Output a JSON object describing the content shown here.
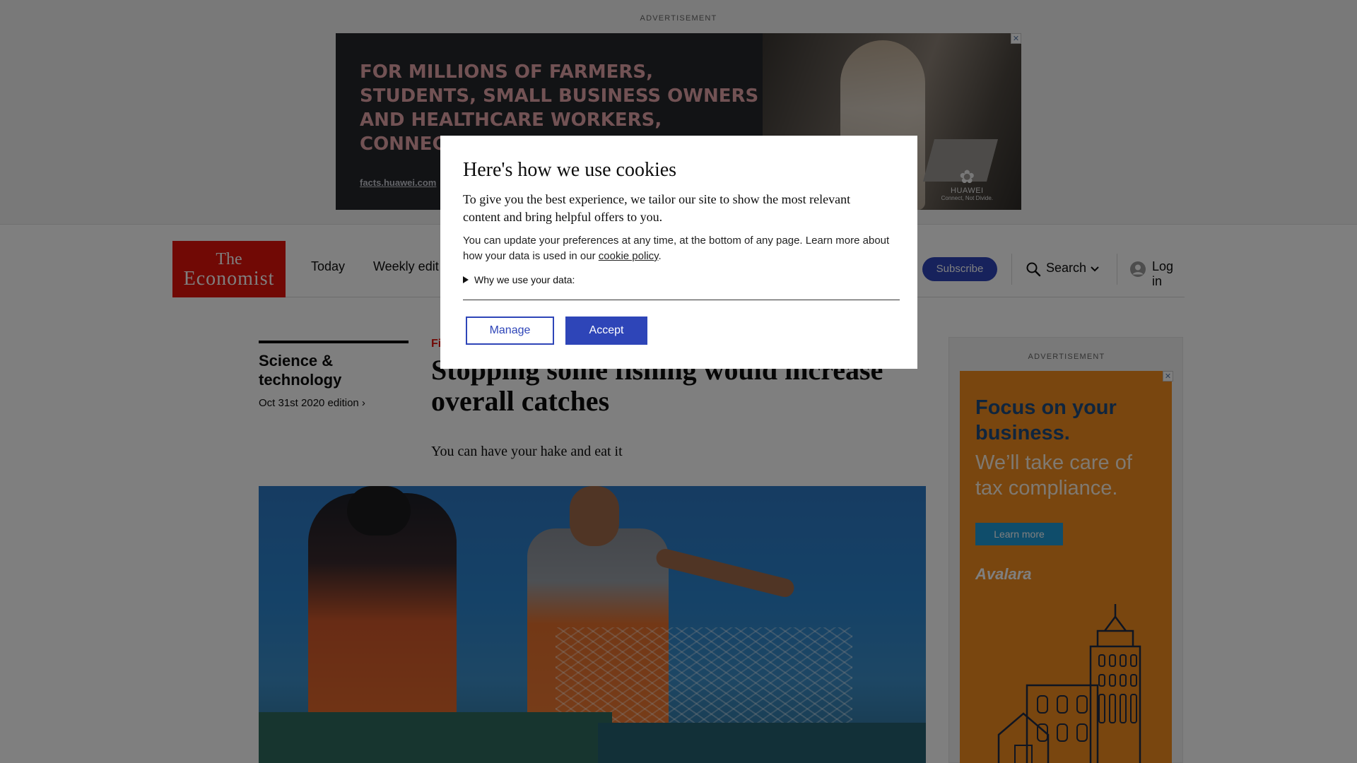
{
  "top_ad": {
    "label": "ADVERTISEMENT",
    "copy": "FOR MILLIONS OF FARMERS, STUDENTS, SMALL BUSINESS OWNERS AND HEALTHCARE WORKERS, CONNECTIVITY IS MORE CR",
    "url": "facts.huawei.com",
    "brand_name": "HUAWEI",
    "brand_tagline": "Connect, Not Divide.",
    "close_glyph": "✕"
  },
  "nav": {
    "logo_line1": "The",
    "logo_line2": "Economist",
    "links": [
      "Today",
      "Weekly edit"
    ],
    "subscribe_label": "Subscribe",
    "search_label": "Search",
    "login_label": "Log in",
    "icons": [
      "search-icon",
      "chevron-down-icon",
      "user-icon"
    ]
  },
  "article": {
    "section": "Science & technology",
    "edition_link": "Oct 31st 2020 edition ›",
    "flytitle": "Fi",
    "headline": "Stopping some fishing would increase overall catches",
    "rubric": "You can have your hake and eat it"
  },
  "side_ad": {
    "label": "ADVERTISEMENT",
    "heading": "Focus on your business.",
    "subheading": "We’ll take care of tax compliance.",
    "cta": "Learn more",
    "brand": "Avalara",
    "close_glyph": "✕"
  },
  "cookie_dialog": {
    "title": "Here's how we use cookies",
    "lead": "To give you the best experience, we tailor our site to show the most relevant content and bring helpful offers to you.",
    "small_text": "You can update your preferences at any time, at the bottom of any page. Learn more about how your data is used in our ",
    "cookie_link": "cookie policy",
    "small_suffix": ".",
    "details_label": "Why we use your data:",
    "manage_label": "Manage",
    "accept_label": "Accept"
  },
  "colors": {
    "brand_red": "#e3120b",
    "accent_blue": "#2e45b8",
    "side_ad_orange": "#f28c1e"
  }
}
